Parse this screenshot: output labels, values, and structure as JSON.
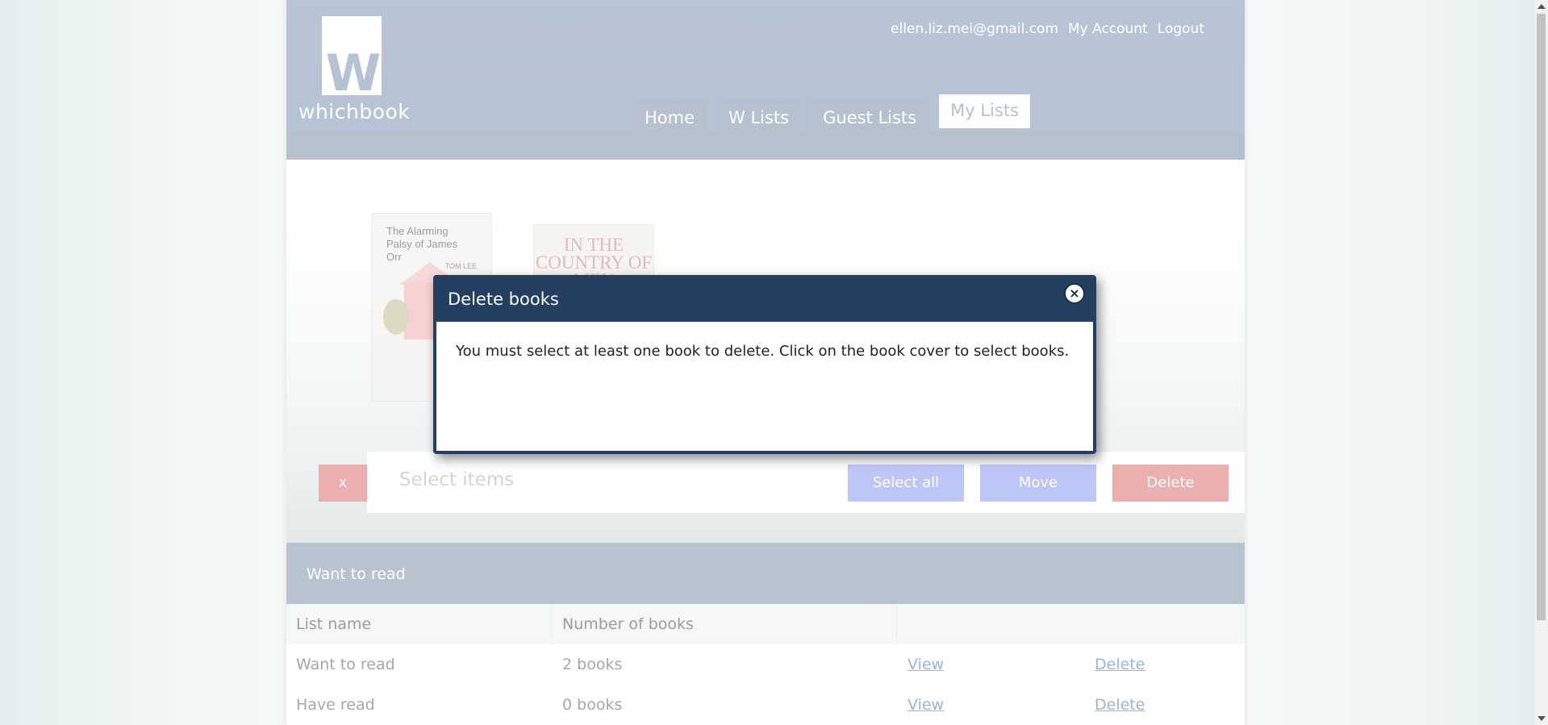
{
  "header": {
    "logo_letter": "W",
    "logo_text": "whichbook",
    "user_email": "ellen.liz.mei@gmail.com",
    "my_account": "My Account",
    "logout": "Logout"
  },
  "nav": {
    "tabs": [
      {
        "label": "Home"
      },
      {
        "label": "W Lists"
      },
      {
        "label": "Guest Lists"
      },
      {
        "label": "My Lists",
        "active": true
      }
    ]
  },
  "books": [
    {
      "title": "The Alarming Palsy of James Orr",
      "author": "TOM LEE"
    },
    {
      "title": "IN THE COUNTRY OF MEN"
    }
  ],
  "toolbar": {
    "close_label": "x",
    "select_placeholder": "Select items",
    "select_all": "Select all",
    "move": "Move",
    "delete": "Delete"
  },
  "lists_section": {
    "title": "Want to read",
    "columns": [
      "List name",
      "Number of books"
    ],
    "rows": [
      {
        "name": "Want to read",
        "count": "2 books",
        "view": "View",
        "delete": "Delete"
      },
      {
        "name": "Have read",
        "count": "0 books",
        "view": "View",
        "delete": "Delete"
      }
    ]
  },
  "dialog": {
    "title": "Delete books",
    "close_icon": "close-circle-icon",
    "message": "You must select at least one book to delete. Click on the book cover to select books."
  },
  "colors": {
    "header_bg": "#8ea2bd",
    "dialog_bg": "#253f63",
    "primary_button": "#9aa9f3",
    "danger_button": "#e28484"
  }
}
